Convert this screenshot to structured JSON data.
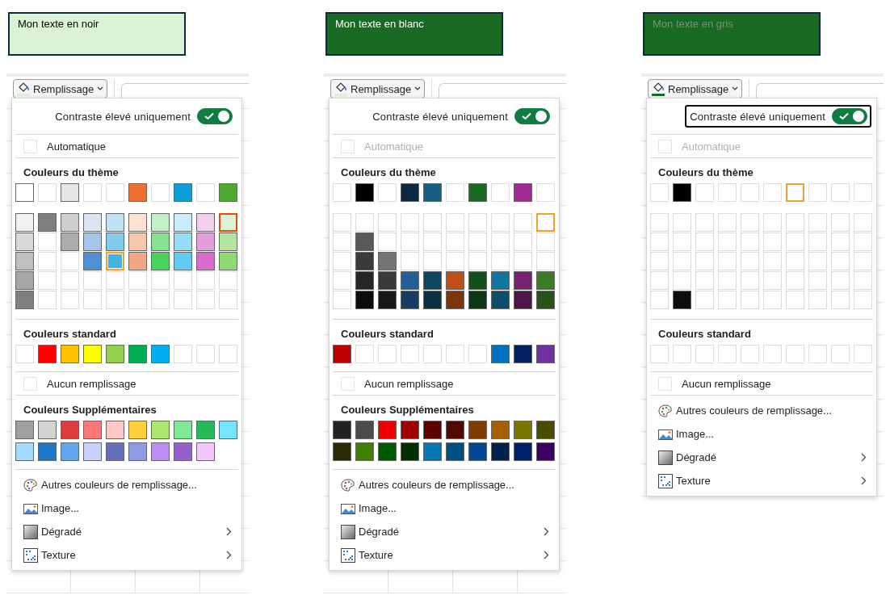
{
  "panels": [
    {
      "sample": {
        "color": "#dcf2d4",
        "label": {
          "text": "Mon texte en noir",
          "color": "#000000"
        }
      },
      "button": {
        "label": "Remplissage",
        "indicator": {
          "color": "#dcf2d4"
        }
      },
      "toggle": {
        "label": "Contraste élevé uniquement",
        "on": true,
        "focused": false
      },
      "automatic": {
        "label": "Automatique",
        "disabled": false
      },
      "theme_colors": {
        "heading": "Couleurs du thème",
        "top": [
          {
            "kind": "color",
            "color": "#ffffff",
            "selected": false,
            "hovered": false
          },
          {
            "kind": "empty",
            "selected": false,
            "hovered": false
          },
          {
            "kind": "color",
            "color": "#e7e6e6",
            "selected": false,
            "hovered": false
          },
          {
            "kind": "empty",
            "selected": false,
            "hovered": false
          },
          {
            "kind": "empty",
            "selected": false,
            "hovered": false
          },
          {
            "kind": "color",
            "color": "#ed7031",
            "selected": false,
            "hovered": false
          },
          {
            "kind": "empty",
            "selected": false,
            "hovered": false
          },
          {
            "kind": "color",
            "color": "#0e9fd8",
            "selected": false,
            "hovered": false
          },
          {
            "kind": "empty",
            "selected": false,
            "hovered": false
          },
          {
            "kind": "color",
            "color": "#4ea72e",
            "selected": false,
            "hovered": false
          }
        ],
        "shades": [
          [
            {
              "kind": "color",
              "color": "#f2f2f2",
              "selected": false,
              "hovered": false
            },
            {
              "kind": "color",
              "color": "#7f7f7f",
              "selected": false,
              "hovered": false
            },
            {
              "kind": "color",
              "color": "#d0cece",
              "selected": false,
              "hovered": false
            },
            {
              "kind": "color",
              "color": "#dae5f3",
              "selected": false,
              "hovered": false
            },
            {
              "kind": "color",
              "color": "#c1e4f5",
              "selected": false,
              "hovered": false
            },
            {
              "kind": "color",
              "color": "#fbe2d5",
              "selected": false,
              "hovered": false
            },
            {
              "kind": "color",
              "color": "#c2f1c8",
              "selected": false,
              "hovered": false
            },
            {
              "kind": "color",
              "color": "#caedfb",
              "selected": false,
              "hovered": false
            },
            {
              "kind": "color",
              "color": "#f2ceef",
              "selected": false,
              "hovered": false
            },
            {
              "kind": "color",
              "color": "#dcf2d4",
              "selected": true,
              "hovered": false
            }
          ],
          [
            {
              "kind": "color",
              "color": "#d9d9d9",
              "selected": false,
              "hovered": false
            },
            {
              "kind": "empty",
              "selected": false,
              "hovered": false
            },
            {
              "kind": "color",
              "color": "#aeabab",
              "selected": false,
              "hovered": false
            },
            {
              "kind": "color",
              "color": "#a6c5e9",
              "selected": false,
              "hovered": false
            },
            {
              "kind": "color",
              "color": "#83cbeb",
              "selected": false,
              "hovered": false
            },
            {
              "kind": "color",
              "color": "#f7c7ac",
              "selected": false,
              "hovered": false
            },
            {
              "kind": "color",
              "color": "#84e291",
              "selected": false,
              "hovered": false
            },
            {
              "kind": "color",
              "color": "#94dcf8",
              "selected": false,
              "hovered": false
            },
            {
              "kind": "color",
              "color": "#e59edd",
              "selected": false,
              "hovered": false
            },
            {
              "kind": "color",
              "color": "#b3e5a1",
              "selected": false,
              "hovered": false
            }
          ],
          [
            {
              "kind": "color",
              "color": "#bfbfbf",
              "selected": false,
              "hovered": false
            },
            {
              "kind": "empty",
              "selected": false,
              "hovered": false
            },
            {
              "kind": "empty",
              "selected": false,
              "hovered": false
            },
            {
              "kind": "color",
              "color": "#4e90d8",
              "selected": false,
              "hovered": false
            },
            {
              "kind": "color",
              "color": "#44b2e2",
              "selected": false,
              "hovered": true
            },
            {
              "kind": "color",
              "color": "#f1a983",
              "selected": false,
              "hovered": false
            },
            {
              "kind": "color",
              "color": "#47d45a",
              "selected": false,
              "hovered": false
            },
            {
              "kind": "color",
              "color": "#61cbf3",
              "selected": false,
              "hovered": false
            },
            {
              "kind": "color",
              "color": "#d86dcd",
              "selected": false,
              "hovered": false
            },
            {
              "kind": "color",
              "color": "#8ed973",
              "selected": false,
              "hovered": false
            }
          ],
          [
            {
              "kind": "color",
              "color": "#a6a6a6",
              "selected": false,
              "hovered": false
            },
            {
              "kind": "empty",
              "selected": false,
              "hovered": false
            },
            {
              "kind": "empty",
              "selected": false,
              "hovered": false
            },
            {
              "kind": "empty",
              "selected": false,
              "hovered": false
            },
            {
              "kind": "empty",
              "selected": false,
              "hovered": false
            },
            {
              "kind": "empty",
              "selected": false,
              "hovered": false
            },
            {
              "kind": "empty",
              "selected": false,
              "hovered": false
            },
            {
              "kind": "empty",
              "selected": false,
              "hovered": false
            },
            {
              "kind": "empty",
              "selected": false,
              "hovered": false
            },
            {
              "kind": "empty",
              "selected": false,
              "hovered": false
            }
          ],
          [
            {
              "kind": "color",
              "color": "#7f7f7f",
              "selected": false,
              "hovered": false
            },
            {
              "kind": "empty",
              "selected": false,
              "hovered": false
            },
            {
              "kind": "empty",
              "selected": false,
              "hovered": false
            },
            {
              "kind": "empty",
              "selected": false,
              "hovered": false
            },
            {
              "kind": "empty",
              "selected": false,
              "hovered": false
            },
            {
              "kind": "empty",
              "selected": false,
              "hovered": false
            },
            {
              "kind": "empty",
              "selected": false,
              "hovered": false
            },
            {
              "kind": "empty",
              "selected": false,
              "hovered": false
            },
            {
              "kind": "empty",
              "selected": false,
              "hovered": false
            },
            {
              "kind": "empty",
              "selected": false,
              "hovered": false
            }
          ]
        ]
      },
      "standard_colors": {
        "heading": "Couleurs standard",
        "swatches": [
          {
            "kind": "empty",
            "selected": false,
            "hovered": false
          },
          {
            "kind": "color",
            "color": "#ff0000",
            "selected": false,
            "hovered": false
          },
          {
            "kind": "color",
            "color": "#ffc000",
            "selected": false,
            "hovered": false
          },
          {
            "kind": "color",
            "color": "#ffff00",
            "selected": false,
            "hovered": false
          },
          {
            "kind": "color",
            "color": "#92d050",
            "selected": false,
            "hovered": false
          },
          {
            "kind": "color",
            "color": "#00b050",
            "selected": false,
            "hovered": false
          },
          {
            "kind": "color",
            "color": "#00b0f0",
            "selected": false,
            "hovered": false
          },
          {
            "kind": "empty",
            "selected": false,
            "hovered": false
          },
          {
            "kind": "empty",
            "selected": false,
            "hovered": false
          },
          {
            "kind": "empty",
            "selected": false,
            "hovered": false
          }
        ]
      },
      "no_fill": {
        "label": "Aucun remplissage"
      },
      "extra_colors": {
        "heading": "Couleurs Supplémentaires",
        "rows": [
          [
            {
              "kind": "color",
              "color": "#a0a0a0",
              "selected": false,
              "hovered": false
            },
            {
              "kind": "color",
              "color": "#d3d3d3",
              "selected": false,
              "hovered": false
            },
            {
              "kind": "color",
              "color": "#dc3c3c",
              "selected": false,
              "hovered": false
            },
            {
              "kind": "color",
              "color": "#ff7777",
              "selected": false,
              "hovered": false
            },
            {
              "kind": "color",
              "color": "#ffc8c8",
              "selected": false,
              "hovered": false
            },
            {
              "kind": "color",
              "color": "#ffd03c",
              "selected": false,
              "hovered": false
            },
            {
              "kind": "color",
              "color": "#aee672",
              "selected": false,
              "hovered": false
            },
            {
              "kind": "color",
              "color": "#7ee896",
              "selected": false,
              "hovered": false
            },
            {
              "kind": "color",
              "color": "#28b95c",
              "selected": false,
              "hovered": false
            },
            {
              "kind": "color",
              "color": "#76e4fc",
              "selected": false,
              "hovered": false
            }
          ],
          [
            {
              "kind": "color",
              "color": "#a5dcfe",
              "selected": false,
              "hovered": false
            },
            {
              "kind": "color",
              "color": "#2078c8",
              "selected": false,
              "hovered": false
            },
            {
              "kind": "color",
              "color": "#64a5f0",
              "selected": false,
              "hovered": false
            },
            {
              "kind": "color",
              "color": "#c8d2fe",
              "selected": false,
              "hovered": false
            },
            {
              "kind": "color",
              "color": "#6370b8",
              "selected": false,
              "hovered": false
            },
            {
              "kind": "color",
              "color": "#8f9be4",
              "selected": false,
              "hovered": false
            },
            {
              "kind": "color",
              "color": "#c08cf5",
              "selected": false,
              "hovered": false
            },
            {
              "kind": "color",
              "color": "#9460cc",
              "selected": false,
              "hovered": false
            },
            {
              "kind": "color",
              "color": "#f4c7fc",
              "selected": false,
              "hovered": false
            }
          ]
        ]
      },
      "menu_items": [
        {
          "kind": "palette",
          "label": "Autres couleurs de remplissage...",
          "submenu": false
        },
        {
          "kind": "image",
          "label": "Image...",
          "submenu": false
        },
        {
          "kind": "gradient",
          "label": "Dégradé",
          "submenu": true
        },
        {
          "kind": "texture",
          "label": "Texture",
          "submenu": true
        }
      ]
    },
    {
      "sample": {
        "color": "#196b24",
        "label": {
          "text": "Mon texte en blanc",
          "color": "#ffffff"
        }
      },
      "button": {
        "label": "Remplissage",
        "indicator": {
          "color": "#dcf2d4"
        }
      },
      "toggle": {
        "label": "Contraste élevé uniquement",
        "on": true,
        "focused": false
      },
      "automatic": {
        "label": "Automatique",
        "disabled": true
      },
      "theme_colors": {
        "heading": "Couleurs du thème",
        "top": [
          {
            "kind": "empty",
            "selected": false,
            "hovered": false
          },
          {
            "kind": "color",
            "color": "#000000",
            "selected": false,
            "hovered": false
          },
          {
            "kind": "empty",
            "selected": false,
            "hovered": false
          },
          {
            "kind": "color",
            "color": "#0e2841",
            "selected": false,
            "hovered": false
          },
          {
            "kind": "color",
            "color": "#156082",
            "selected": false,
            "hovered": false
          },
          {
            "kind": "empty",
            "selected": false,
            "hovered": false
          },
          {
            "kind": "color",
            "color": "#196b24",
            "selected": false,
            "hovered": false
          },
          {
            "kind": "empty",
            "selected": false,
            "hovered": false
          },
          {
            "kind": "color",
            "color": "#a02b93",
            "selected": false,
            "hovered": false
          },
          {
            "kind": "empty",
            "selected": false,
            "hovered": false
          }
        ],
        "shades": [
          [
            {
              "kind": "empty",
              "selected": false,
              "hovered": false
            },
            {
              "kind": "empty",
              "selected": false,
              "hovered": false
            },
            {
              "kind": "empty",
              "selected": false,
              "hovered": false
            },
            {
              "kind": "empty",
              "selected": false,
              "hovered": false
            },
            {
              "kind": "empty",
              "selected": false,
              "hovered": false
            },
            {
              "kind": "empty",
              "selected": false,
              "hovered": false
            },
            {
              "kind": "empty",
              "selected": false,
              "hovered": false
            },
            {
              "kind": "empty",
              "selected": false,
              "hovered": false
            },
            {
              "kind": "empty",
              "selected": false,
              "hovered": false
            },
            {
              "kind": "empty",
              "selected": false,
              "hovered": true
            }
          ],
          [
            {
              "kind": "empty",
              "selected": false,
              "hovered": false
            },
            {
              "kind": "color",
              "color": "#595959",
              "selected": false,
              "hovered": false
            },
            {
              "kind": "empty",
              "selected": false,
              "hovered": false
            },
            {
              "kind": "empty",
              "selected": false,
              "hovered": false
            },
            {
              "kind": "empty",
              "selected": false,
              "hovered": false
            },
            {
              "kind": "empty",
              "selected": false,
              "hovered": false
            },
            {
              "kind": "empty",
              "selected": false,
              "hovered": false
            },
            {
              "kind": "empty",
              "selected": false,
              "hovered": false
            },
            {
              "kind": "empty",
              "selected": false,
              "hovered": false
            },
            {
              "kind": "empty",
              "selected": false,
              "hovered": false
            }
          ],
          [
            {
              "kind": "empty",
              "selected": false,
              "hovered": false
            },
            {
              "kind": "color",
              "color": "#3a3a3a",
              "selected": false,
              "hovered": false
            },
            {
              "kind": "color",
              "color": "#747474",
              "selected": false,
              "hovered": false
            },
            {
              "kind": "empty",
              "selected": false,
              "hovered": false
            },
            {
              "kind": "empty",
              "selected": false,
              "hovered": false
            },
            {
              "kind": "empty",
              "selected": false,
              "hovered": false
            },
            {
              "kind": "empty",
              "selected": false,
              "hovered": false
            },
            {
              "kind": "empty",
              "selected": false,
              "hovered": false
            },
            {
              "kind": "empty",
              "selected": false,
              "hovered": false
            },
            {
              "kind": "empty",
              "selected": false,
              "hovered": false
            }
          ],
          [
            {
              "kind": "empty",
              "selected": false,
              "hovered": false
            },
            {
              "kind": "color",
              "color": "#262626",
              "selected": false,
              "hovered": false
            },
            {
              "kind": "color",
              "color": "#3a3a3a",
              "selected": false,
              "hovered": false
            },
            {
              "kind": "color",
              "color": "#215f9a",
              "selected": false,
              "hovered": false
            },
            {
              "kind": "color",
              "color": "#0f4761",
              "selected": false,
              "hovered": false
            },
            {
              "kind": "color",
              "color": "#c04f15",
              "selected": false,
              "hovered": false
            },
            {
              "kind": "color",
              "color": "#124f1b",
              "selected": false,
              "hovered": false
            },
            {
              "kind": "color",
              "color": "#0f76a0",
              "selected": false,
              "hovered": false
            },
            {
              "kind": "color",
              "color": "#782170",
              "selected": false,
              "hovered": false
            },
            {
              "kind": "color",
              "color": "#3b7d23",
              "selected": false,
              "hovered": false
            }
          ],
          [
            {
              "kind": "empty",
              "selected": false,
              "hovered": false
            },
            {
              "kind": "color",
              "color": "#0d0d0d",
              "selected": false,
              "hovered": false
            },
            {
              "kind": "color",
              "color": "#171717",
              "selected": false,
              "hovered": false
            },
            {
              "kind": "color",
              "color": "#153d64",
              "selected": false,
              "hovered": false
            },
            {
              "kind": "color",
              "color": "#0b3041",
              "selected": false,
              "hovered": false
            },
            {
              "kind": "color",
              "color": "#7e350e",
              "selected": false,
              "hovered": false
            },
            {
              "kind": "color",
              "color": "#0c3512",
              "selected": false,
              "hovered": false
            },
            {
              "kind": "color",
              "color": "#0a4f6c",
              "selected": false,
              "hovered": false
            },
            {
              "kind": "color",
              "color": "#4f1549",
              "selected": false,
              "hovered": false
            },
            {
              "kind": "color",
              "color": "#275317",
              "selected": false,
              "hovered": false
            }
          ]
        ]
      },
      "standard_colors": {
        "heading": "Couleurs standard",
        "swatches": [
          {
            "kind": "color",
            "color": "#c00000",
            "selected": false,
            "hovered": false
          },
          {
            "kind": "empty",
            "selected": false,
            "hovered": false
          },
          {
            "kind": "empty",
            "selected": false,
            "hovered": false
          },
          {
            "kind": "empty",
            "selected": false,
            "hovered": false
          },
          {
            "kind": "empty",
            "selected": false,
            "hovered": false
          },
          {
            "kind": "empty",
            "selected": false,
            "hovered": false
          },
          {
            "kind": "empty",
            "selected": false,
            "hovered": false
          },
          {
            "kind": "color",
            "color": "#0070c0",
            "selected": false,
            "hovered": false
          },
          {
            "kind": "color",
            "color": "#002060",
            "selected": false,
            "hovered": false
          },
          {
            "kind": "color",
            "color": "#7030a0",
            "selected": false,
            "hovered": false
          }
        ]
      },
      "no_fill": {
        "label": "Aucun remplissage"
      },
      "extra_colors": {
        "heading": "Couleurs Supplémentaires",
        "rows": [
          [
            {
              "kind": "color",
              "color": "#222222",
              "selected": false,
              "hovered": false
            },
            {
              "kind": "color",
              "color": "#4b4b4b",
              "selected": false,
              "hovered": false
            },
            {
              "kind": "color",
              "color": "#ee0000",
              "selected": false,
              "hovered": false
            },
            {
              "kind": "color",
              "color": "#a00000",
              "selected": false,
              "hovered": false
            },
            {
              "kind": "color",
              "color": "#5c0000",
              "selected": false,
              "hovered": false
            },
            {
              "kind": "color",
              "color": "#500a00",
              "selected": false,
              "hovered": false
            },
            {
              "kind": "color",
              "color": "#7e3c00",
              "selected": false,
              "hovered": false
            },
            {
              "kind": "color",
              "color": "#a66000",
              "selected": false,
              "hovered": false
            },
            {
              "kind": "color",
              "color": "#787600",
              "selected": false,
              "hovered": false
            },
            {
              "kind": "color",
              "color": "#4c4c00",
              "selected": false,
              "hovered": false
            }
          ],
          [
            {
              "kind": "color",
              "color": "#2a2a00",
              "selected": false,
              "hovered": false
            },
            {
              "kind": "color",
              "color": "#3a8200",
              "selected": false,
              "hovered": false
            },
            {
              "kind": "color",
              "color": "#005a00",
              "selected": false,
              "hovered": false
            },
            {
              "kind": "color",
              "color": "#003000",
              "selected": false,
              "hovered": false
            },
            {
              "kind": "color",
              "color": "#0078b4",
              "selected": false,
              "hovered": false
            },
            {
              "kind": "color",
              "color": "#004f82",
              "selected": false,
              "hovered": false
            },
            {
              "kind": "color",
              "color": "#004898",
              "selected": false,
              "hovered": false
            },
            {
              "kind": "color",
              "color": "#002050",
              "selected": false,
              "hovered": false
            },
            {
              "kind": "color",
              "color": "#00206c",
              "selected": false,
              "hovered": false
            },
            {
              "kind": "color",
              "color": "#3c0064",
              "selected": false,
              "hovered": false
            }
          ]
        ]
      },
      "menu_items": [
        {
          "kind": "palette",
          "label": "Autres couleurs de remplissage...",
          "submenu": false
        },
        {
          "kind": "image",
          "label": "Image...",
          "submenu": false
        },
        {
          "kind": "gradient",
          "label": "Dégradé",
          "submenu": true
        },
        {
          "kind": "texture",
          "label": "Texture",
          "submenu": true
        }
      ]
    },
    {
      "sample": {
        "color": "#196b24",
        "label": {
          "text": "Mon texte en gris",
          "color": "#7f8c7f"
        }
      },
      "button": {
        "label": "Remplissage",
        "indicator": {
          "color": "#196b24"
        }
      },
      "toggle": {
        "label": "Contraste élevé uniquement",
        "on": true,
        "focused": true
      },
      "automatic": {
        "label": "Automatique",
        "disabled": true
      },
      "theme_colors": {
        "heading": "Couleurs du thème",
        "top": [
          {
            "kind": "empty",
            "selected": false,
            "hovered": false
          },
          {
            "kind": "color",
            "color": "#000000",
            "selected": false,
            "hovered": false
          },
          {
            "kind": "empty",
            "selected": false,
            "hovered": false
          },
          {
            "kind": "empty",
            "selected": false,
            "hovered": false
          },
          {
            "kind": "empty",
            "selected": false,
            "hovered": false
          },
          {
            "kind": "empty",
            "selected": false,
            "hovered": false
          },
          {
            "kind": "empty",
            "selected": false,
            "hovered": true
          },
          {
            "kind": "empty",
            "selected": false,
            "hovered": false
          },
          {
            "kind": "empty",
            "selected": false,
            "hovered": false
          },
          {
            "kind": "empty",
            "selected": false,
            "hovered": false
          }
        ],
        "shades": [
          [
            {
              "kind": "empty",
              "selected": false,
              "hovered": false
            },
            {
              "kind": "empty",
              "selected": false,
              "hovered": false
            },
            {
              "kind": "empty",
              "selected": false,
              "hovered": false
            },
            {
              "kind": "empty",
              "selected": false,
              "hovered": false
            },
            {
              "kind": "empty",
              "selected": false,
              "hovered": false
            },
            {
              "kind": "empty",
              "selected": false,
              "hovered": false
            },
            {
              "kind": "empty",
              "selected": false,
              "hovered": false
            },
            {
              "kind": "empty",
              "selected": false,
              "hovered": false
            },
            {
              "kind": "empty",
              "selected": false,
              "hovered": false
            },
            {
              "kind": "empty",
              "selected": false,
              "hovered": false
            }
          ],
          [
            {
              "kind": "empty",
              "selected": false,
              "hovered": false
            },
            {
              "kind": "empty",
              "selected": false,
              "hovered": false
            },
            {
              "kind": "empty",
              "selected": false,
              "hovered": false
            },
            {
              "kind": "empty",
              "selected": false,
              "hovered": false
            },
            {
              "kind": "empty",
              "selected": false,
              "hovered": false
            },
            {
              "kind": "empty",
              "selected": false,
              "hovered": false
            },
            {
              "kind": "empty",
              "selected": false,
              "hovered": false
            },
            {
              "kind": "empty",
              "selected": false,
              "hovered": false
            },
            {
              "kind": "empty",
              "selected": false,
              "hovered": false
            },
            {
              "kind": "empty",
              "selected": false,
              "hovered": false
            }
          ],
          [
            {
              "kind": "empty",
              "selected": false,
              "hovered": false
            },
            {
              "kind": "empty",
              "selected": false,
              "hovered": false
            },
            {
              "kind": "empty",
              "selected": false,
              "hovered": false
            },
            {
              "kind": "empty",
              "selected": false,
              "hovered": false
            },
            {
              "kind": "empty",
              "selected": false,
              "hovered": false
            },
            {
              "kind": "empty",
              "selected": false,
              "hovered": false
            },
            {
              "kind": "empty",
              "selected": false,
              "hovered": false
            },
            {
              "kind": "empty",
              "selected": false,
              "hovered": false
            },
            {
              "kind": "empty",
              "selected": false,
              "hovered": false
            },
            {
              "kind": "empty",
              "selected": false,
              "hovered": false
            }
          ],
          [
            {
              "kind": "empty",
              "selected": false,
              "hovered": false
            },
            {
              "kind": "empty",
              "selected": false,
              "hovered": false
            },
            {
              "kind": "empty",
              "selected": false,
              "hovered": false
            },
            {
              "kind": "empty",
              "selected": false,
              "hovered": false
            },
            {
              "kind": "empty",
              "selected": false,
              "hovered": false
            },
            {
              "kind": "empty",
              "selected": false,
              "hovered": false
            },
            {
              "kind": "empty",
              "selected": false,
              "hovered": false
            },
            {
              "kind": "empty",
              "selected": false,
              "hovered": false
            },
            {
              "kind": "empty",
              "selected": false,
              "hovered": false
            },
            {
              "kind": "empty",
              "selected": false,
              "hovered": false
            }
          ],
          [
            {
              "kind": "empty",
              "selected": false,
              "hovered": false
            },
            {
              "kind": "color",
              "color": "#0d0d0d",
              "selected": false,
              "hovered": false
            },
            {
              "kind": "empty",
              "selected": false,
              "hovered": false
            },
            {
              "kind": "empty",
              "selected": false,
              "hovered": false
            },
            {
              "kind": "empty",
              "selected": false,
              "hovered": false
            },
            {
              "kind": "empty",
              "selected": false,
              "hovered": false
            },
            {
              "kind": "empty",
              "selected": false,
              "hovered": false
            },
            {
              "kind": "empty",
              "selected": false,
              "hovered": false
            },
            {
              "kind": "empty",
              "selected": false,
              "hovered": false
            },
            {
              "kind": "empty",
              "selected": false,
              "hovered": false
            }
          ]
        ]
      },
      "standard_colors": {
        "heading": "Couleurs standard",
        "swatches": [
          {
            "kind": "empty",
            "selected": false,
            "hovered": false
          },
          {
            "kind": "empty",
            "selected": false,
            "hovered": false
          },
          {
            "kind": "empty",
            "selected": false,
            "hovered": false
          },
          {
            "kind": "empty",
            "selected": false,
            "hovered": false
          },
          {
            "kind": "empty",
            "selected": false,
            "hovered": false
          },
          {
            "kind": "empty",
            "selected": false,
            "hovered": false
          },
          {
            "kind": "empty",
            "selected": false,
            "hovered": false
          },
          {
            "kind": "empty",
            "selected": false,
            "hovered": false
          },
          {
            "kind": "empty",
            "selected": false,
            "hovered": false
          },
          {
            "kind": "empty",
            "selected": false,
            "hovered": false
          }
        ]
      },
      "no_fill": {
        "label": "Aucun remplissage"
      },
      "menu_items": [
        {
          "kind": "palette",
          "label": "Autres couleurs de remplissage...",
          "submenu": false
        },
        {
          "kind": "image",
          "label": "Image...",
          "submenu": false
        },
        {
          "kind": "gradient",
          "label": "Dégradé",
          "submenu": true
        },
        {
          "kind": "texture",
          "label": "Texture",
          "submenu": true
        }
      ]
    }
  ]
}
